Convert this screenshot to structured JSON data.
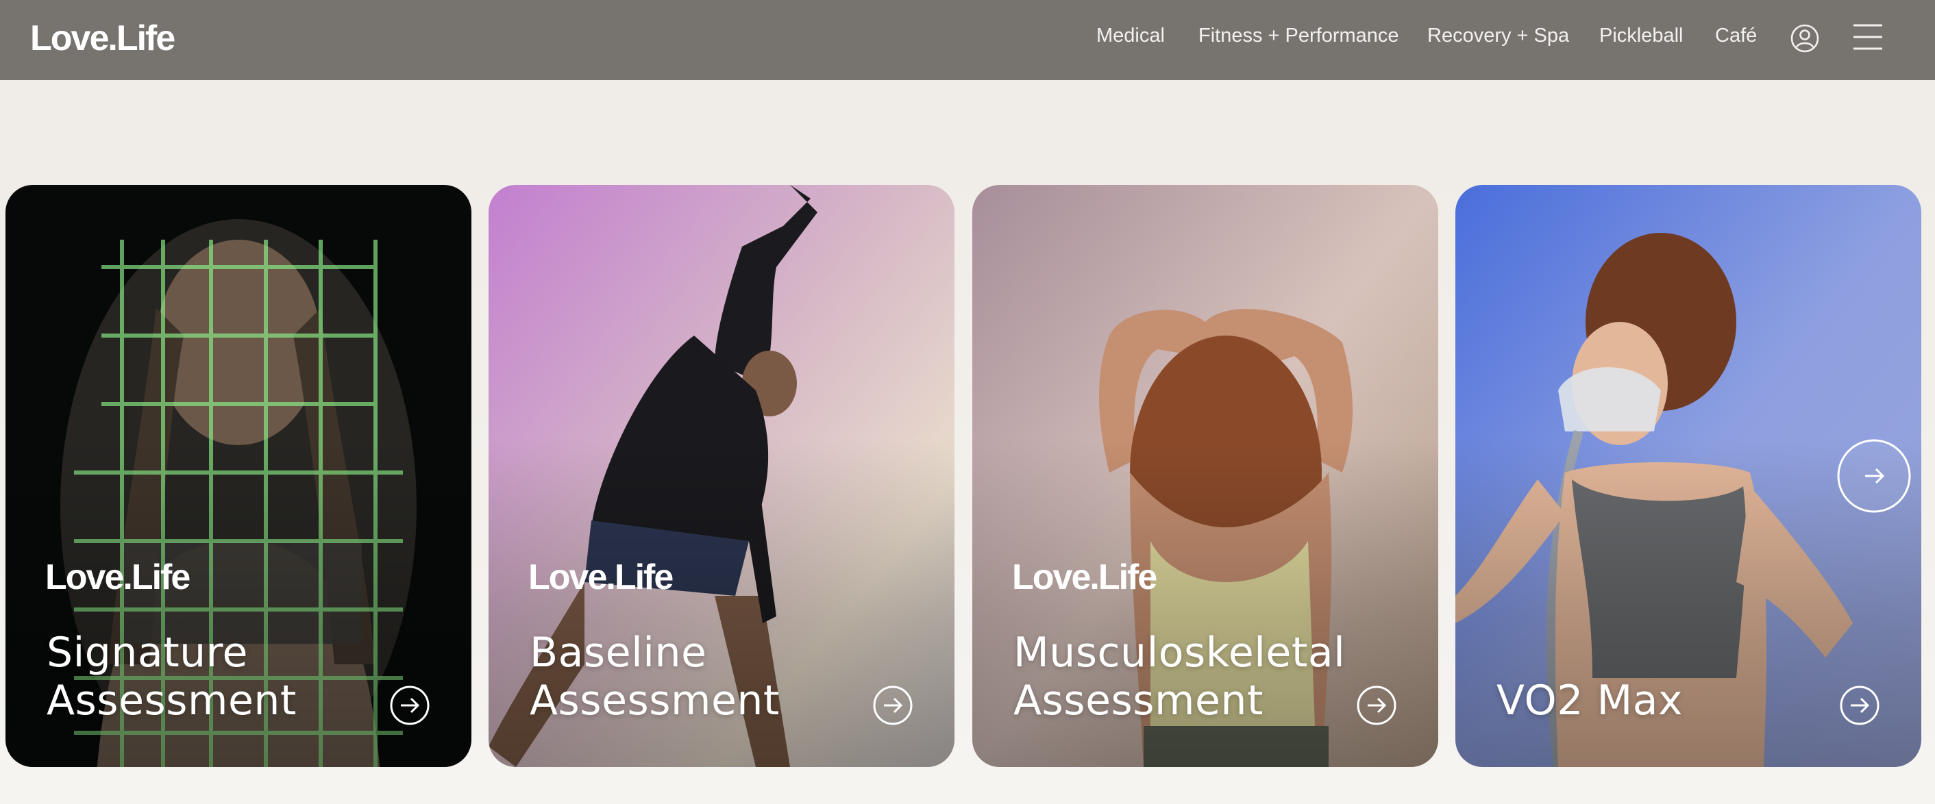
{
  "header": {
    "logo": "Love.Life",
    "nav": [
      {
        "label": "Medical"
      },
      {
        "label": "Fitness + Performance"
      },
      {
        "label": "Recovery + Spa"
      },
      {
        "label": "Pickleball"
      },
      {
        "label": "Café"
      }
    ],
    "icons": [
      "user-icon",
      "menu-icon"
    ]
  },
  "cards": [
    {
      "logo": "Love.Life",
      "title_line1": "Signature",
      "title_line2": "Assessment",
      "arrow_icon": "arrow-right-circle-icon"
    },
    {
      "logo": "Love.Life",
      "title_line1": "Baseline",
      "title_line2": "Assessment",
      "arrow_icon": "arrow-right-circle-icon"
    },
    {
      "logo": "Love.Life",
      "title_line1": "Musculoskeletal",
      "title_line2": "Assessment",
      "arrow_icon": "arrow-right-circle-icon"
    },
    {
      "logo": "",
      "title_line1": "",
      "title_line2": "VO2 Max",
      "arrow_icon": "arrow-right-circle-icon"
    }
  ],
  "carousel": {
    "next_icon": "carousel-next-arrow-icon"
  },
  "colors": {
    "header_bg": "#77736f",
    "page_bg": "#f1eee9",
    "text_light": "#ffffff"
  }
}
